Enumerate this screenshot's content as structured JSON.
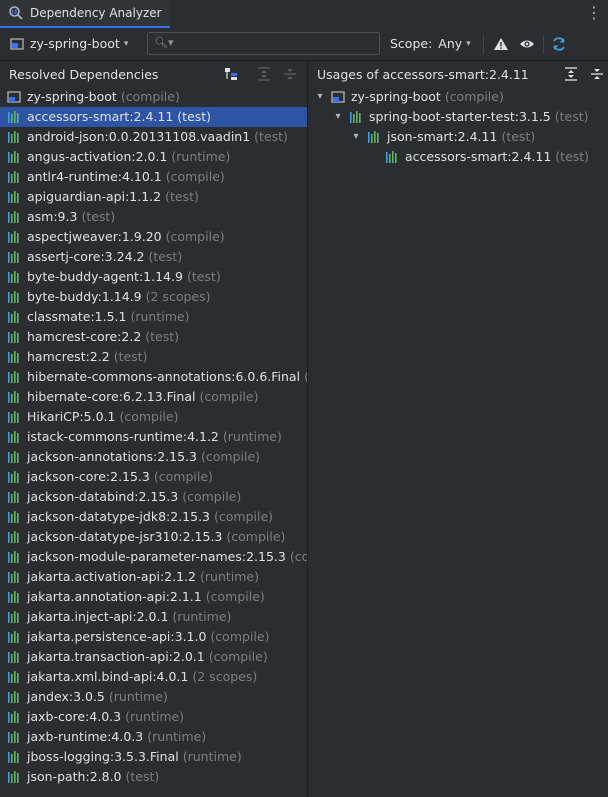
{
  "tab": {
    "title": "Dependency Analyzer"
  },
  "toolbar": {
    "module": "zy-spring-boot",
    "search_value": "",
    "scope_label": "Scope:",
    "scope_value": "Any"
  },
  "left": {
    "title": "Resolved Dependencies",
    "root": {
      "name": "zy-spring-boot",
      "extra": "(compile)"
    },
    "items": [
      {
        "name": "accessors-smart:2.4.11",
        "extra": "(test)",
        "selected": true
      },
      {
        "name": "android-json:0.0.20131108.vaadin1",
        "extra": "(test)"
      },
      {
        "name": "angus-activation:2.0.1",
        "extra": "(runtime)"
      },
      {
        "name": "antlr4-runtime:4.10.1",
        "extra": "(compile)"
      },
      {
        "name": "apiguardian-api:1.1.2",
        "extra": "(test)"
      },
      {
        "name": "asm:9.3",
        "extra": "(test)"
      },
      {
        "name": "aspectjweaver:1.9.20",
        "extra": "(compile)"
      },
      {
        "name": "assertj-core:3.24.2",
        "extra": "(test)"
      },
      {
        "name": "byte-buddy-agent:1.14.9",
        "extra": "(test)"
      },
      {
        "name": "byte-buddy:1.14.9",
        "extra": "(2 scopes)"
      },
      {
        "name": "classmate:1.5.1",
        "extra": "(runtime)"
      },
      {
        "name": "hamcrest-core:2.2",
        "extra": "(test)"
      },
      {
        "name": "hamcrest:2.2",
        "extra": "(test)"
      },
      {
        "name": "hibernate-commons-annotations:6.0.6.Final",
        "extra": "(r"
      },
      {
        "name": "hibernate-core:6.2.13.Final",
        "extra": "(compile)"
      },
      {
        "name": "HikariCP:5.0.1",
        "extra": "(compile)"
      },
      {
        "name": "istack-commons-runtime:4.1.2",
        "extra": "(runtime)"
      },
      {
        "name": "jackson-annotations:2.15.3",
        "extra": "(compile)"
      },
      {
        "name": "jackson-core:2.15.3",
        "extra": "(compile)"
      },
      {
        "name": "jackson-databind:2.15.3",
        "extra": "(compile)"
      },
      {
        "name": "jackson-datatype-jdk8:2.15.3",
        "extra": "(compile)"
      },
      {
        "name": "jackson-datatype-jsr310:2.15.3",
        "extra": "(compile)"
      },
      {
        "name": "jackson-module-parameter-names:2.15.3",
        "extra": "(cor"
      },
      {
        "name": "jakarta.activation-api:2.1.2",
        "extra": "(runtime)"
      },
      {
        "name": "jakarta.annotation-api:2.1.1",
        "extra": "(compile)"
      },
      {
        "name": "jakarta.inject-api:2.0.1",
        "extra": "(runtime)"
      },
      {
        "name": "jakarta.persistence-api:3.1.0",
        "extra": "(compile)"
      },
      {
        "name": "jakarta.transaction-api:2.0.1",
        "extra": "(compile)"
      },
      {
        "name": "jakarta.xml.bind-api:4.0.1",
        "extra": "(2 scopes)"
      },
      {
        "name": "jandex:3.0.5",
        "extra": "(runtime)"
      },
      {
        "name": "jaxb-core:4.0.3",
        "extra": "(runtime)"
      },
      {
        "name": "jaxb-runtime:4.0.3",
        "extra": "(runtime)"
      },
      {
        "name": "jboss-logging:3.5.3.Final",
        "extra": "(runtime)"
      },
      {
        "name": "json-path:2.8.0",
        "extra": "(test)"
      }
    ]
  },
  "right": {
    "title": "Usages of accessors-smart:2.4.11",
    "tree": [
      {
        "name": "zy-spring-boot",
        "extra": "(compile)",
        "level": 0,
        "module": true,
        "expanded": true
      },
      {
        "name": "spring-boot-starter-test:3.1.5",
        "extra": "(test)",
        "level": 1,
        "expanded": true
      },
      {
        "name": "json-smart:2.4.11",
        "extra": "(test)",
        "level": 2,
        "expanded": true
      },
      {
        "name": "accessors-smart:2.4.11",
        "extra": "(test)",
        "level": 3,
        "leaf": true
      }
    ]
  },
  "colors": {
    "accent": "#3574f0",
    "selection": "#2e55a3",
    "dep_icon": "#5fb865",
    "muted": "#7c7f86"
  }
}
